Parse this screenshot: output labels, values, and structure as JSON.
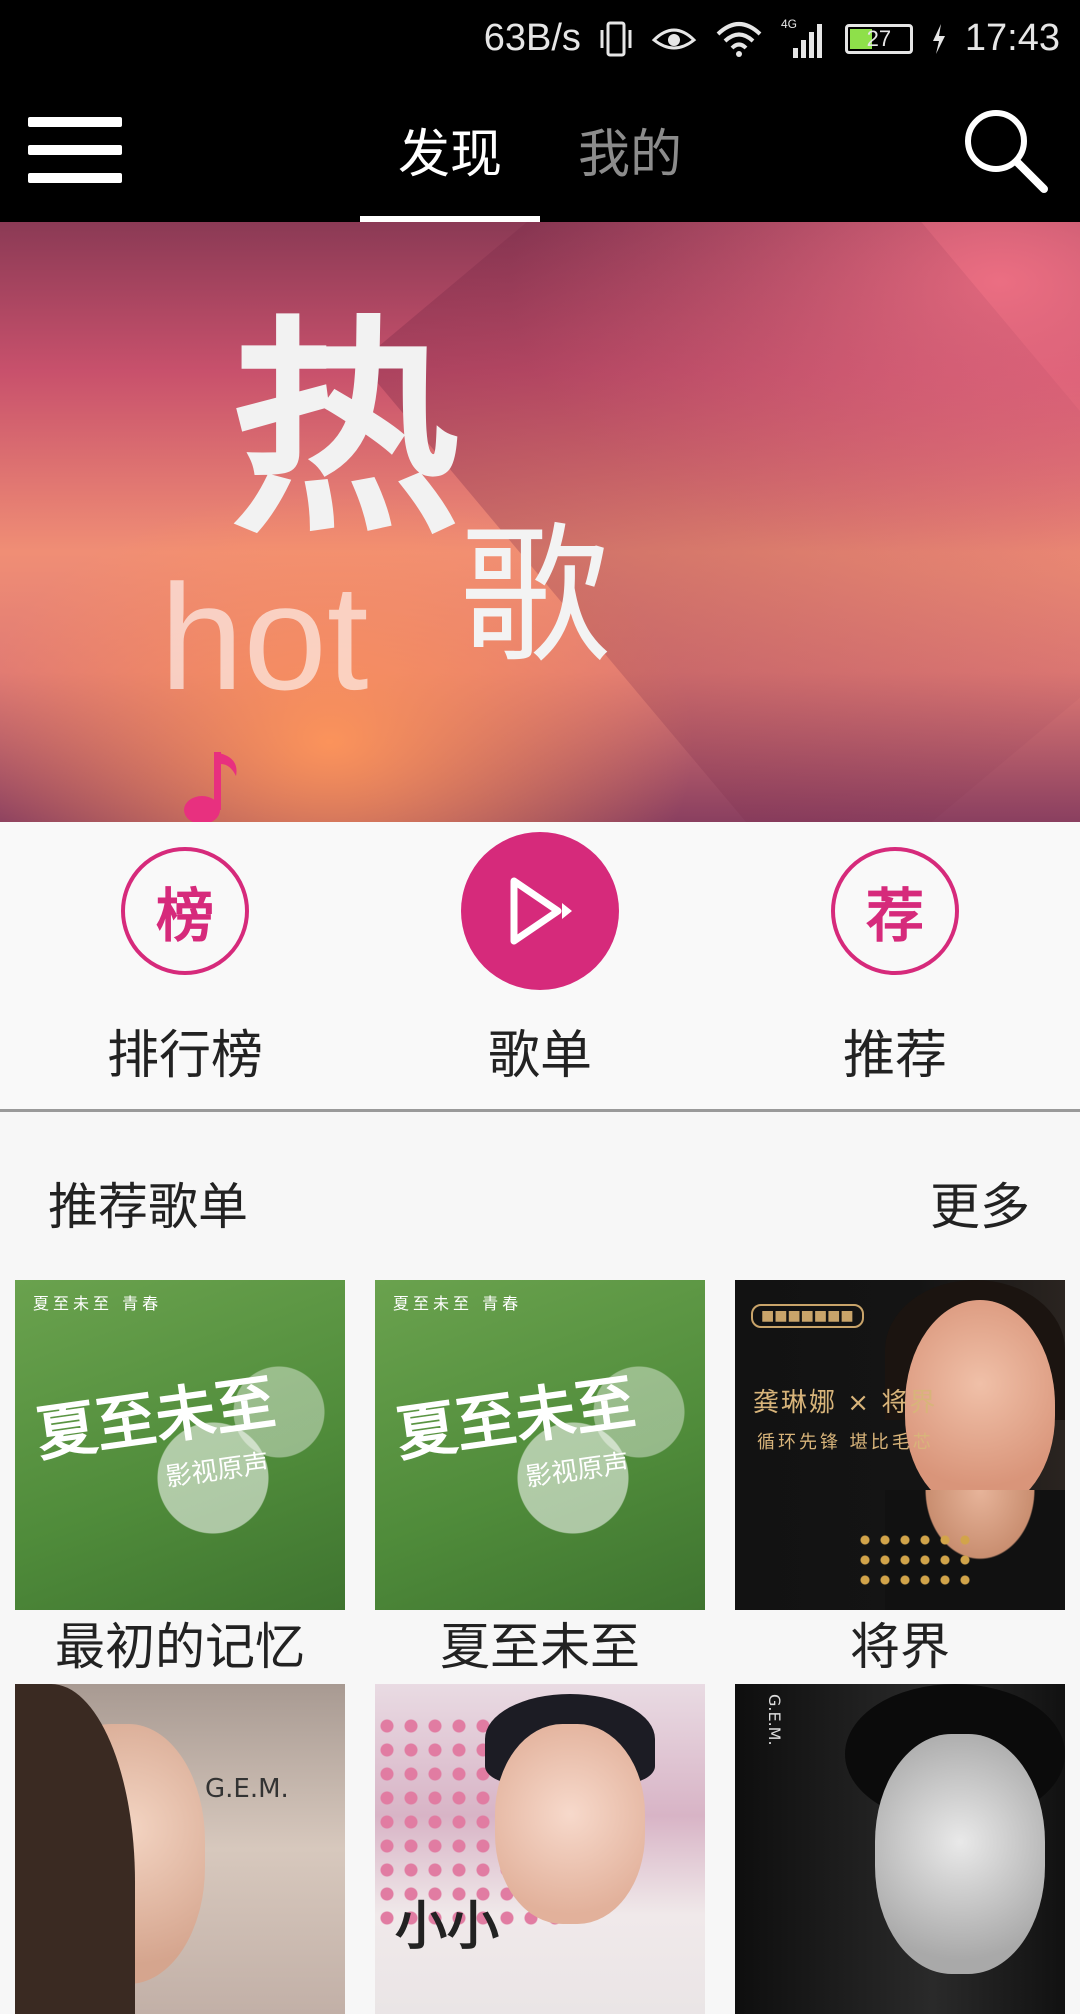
{
  "status_bar": {
    "net_speed": "63B/s",
    "network": "4G",
    "battery": "27",
    "time": "17:43"
  },
  "app_bar": {
    "tabs": [
      {
        "label": "发现",
        "active": true
      },
      {
        "label": "我的",
        "active": false
      }
    ]
  },
  "banner": {
    "title_big": "热",
    "title_song": "歌",
    "title_en": "hot"
  },
  "quick_entries": [
    {
      "icon_text": "榜",
      "label": "排行榜"
    },
    {
      "icon_text": "",
      "label": "歌单"
    },
    {
      "icon_text": "荐",
      "label": "推荐"
    }
  ],
  "section": {
    "title": "推荐歌单",
    "more": "更多"
  },
  "playlists": [
    {
      "title": "最初的记忆",
      "cover": {
        "top": "夏至未至   青春",
        "title": "夏至未至",
        "sub": "影视原声"
      }
    },
    {
      "title": "夏至未至",
      "cover": {
        "top": "夏至未至   青春",
        "title": "夏至未至",
        "sub": "影视原声"
      }
    },
    {
      "title": "将界",
      "cover": {
        "badge": "",
        "title": "龚琳娜 × 将界",
        "sub": "循环先锋   堪比毛芯"
      }
    },
    {
      "title": "",
      "cover": {
        "text": "G.E.M."
      }
    },
    {
      "title": "",
      "cover": {
        "text": "小小"
      }
    },
    {
      "title": "",
      "cover": {
        "text": "G.E.M."
      }
    }
  ],
  "colors": {
    "accent": "#d62a7b",
    "bar_bg": "#000000"
  }
}
